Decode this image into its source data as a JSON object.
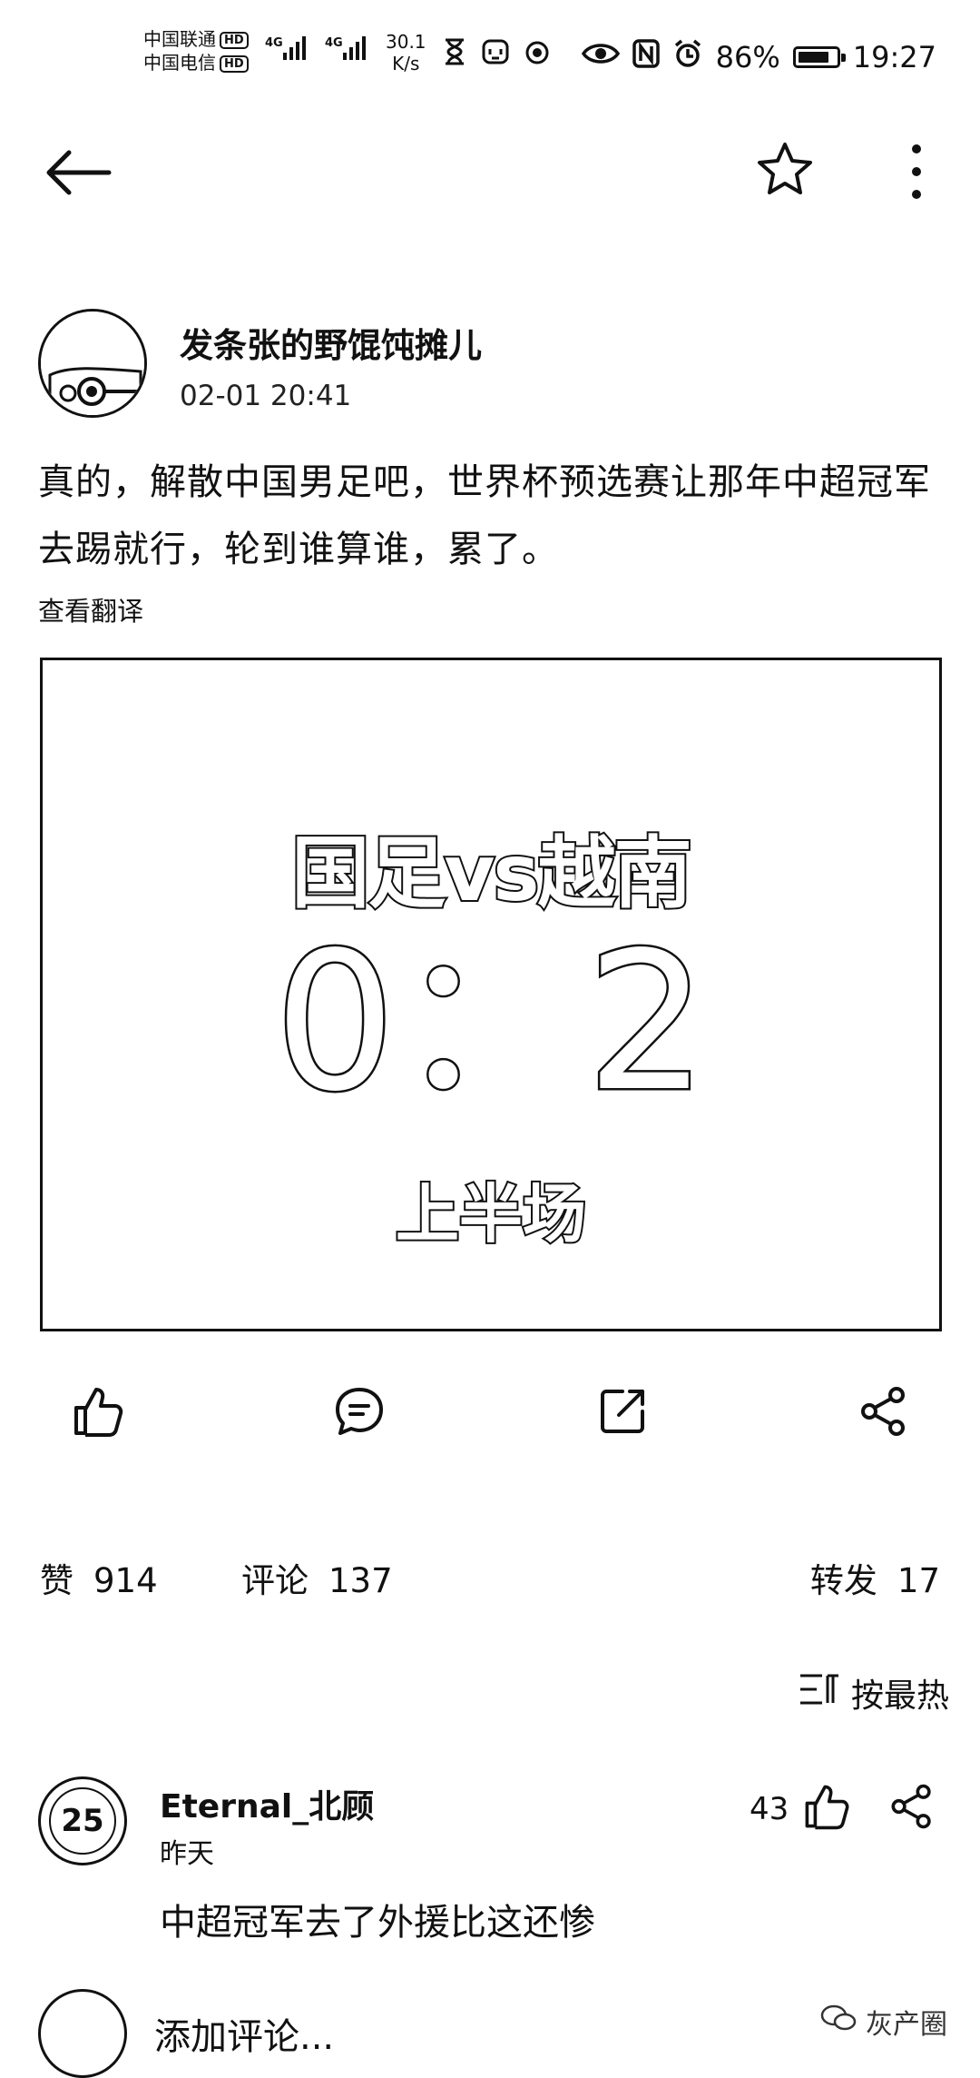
{
  "status_bar": {
    "carrier1": "中国联通",
    "carrier2": "中国电信",
    "hd": "HD",
    "net1": "4G",
    "net2": "4G",
    "speed_value": "30.1",
    "speed_unit": "K/s",
    "battery_percent": "86%",
    "battery_level": 0.86,
    "time": "19:27"
  },
  "post": {
    "author": "发条张的野馄饨摊儿",
    "time": "02-01 20:41",
    "text": "真的，解散中国男足吧，世界杯预选赛让那年中超冠军去踢就行，轮到谁算谁，累了。",
    "translate_label": "查看翻译",
    "image": {
      "title": "国足vs越南",
      "score": "0：2",
      "period": "上半场"
    }
  },
  "stats": {
    "likes_label": "赞",
    "likes": "914",
    "comments_label": "评论",
    "comments": "137",
    "reposts_label": "转发",
    "reposts": "17"
  },
  "sort": {
    "label": "按最热"
  },
  "comment": {
    "avatar_text": "25",
    "name": "Eternal_北顾",
    "time": "昨天",
    "likes": "43",
    "text": "中超冠军去了外援比这还惨"
  },
  "bottom": {
    "placeholder": "添加评论...",
    "watermark": "灰产圈"
  }
}
